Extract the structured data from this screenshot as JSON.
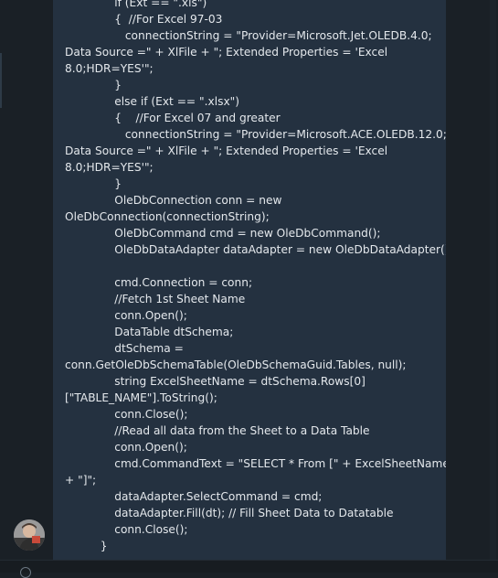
{
  "message": {
    "code_lines": [
      "              if (Ext == \".xls\")",
      "              {  //For Excel 97-03",
      "                 connectionString = \"Provider=Microsoft.Jet.OLEDB.4.0;",
      "Data Source =\" + XlFile + \"; Extended Properties = 'Excel",
      "8.0;HDR=YES'\";",
      "              }",
      "              else if (Ext == \".xlsx\")",
      "              {    //For Excel 07 and greater",
      "                 connectionString = \"Provider=Microsoft.ACE.OLEDB.12.0;",
      "Data Source =\" + XlFile + \"; Extended Properties = 'Excel",
      "8.0;HDR=YES'\";",
      "              }",
      "              OleDbConnection conn = new",
      "OleDbConnection(connectionString);",
      "              OleDbCommand cmd = new OleDbCommand();",
      "              OleDbDataAdapter dataAdapter = new OleDbDataAdapter();",
      "",
      "              cmd.Connection = conn;",
      "              //Fetch 1st Sheet Name",
      "              conn.Open();",
      "              DataTable dtSchema;",
      "              dtSchema =",
      "conn.GetOleDbSchemaTable(OleDbSchemaGuid.Tables, null);",
      "              string ExcelSheetName = dtSchema.Rows[0]",
      "[\"TABLE_NAME\"].ToString();",
      "              conn.Close();",
      "              //Read all data from the Sheet to a Data Table",
      "              conn.Open();",
      "              cmd.CommandText = \"SELECT * From [\" + ExcelSheetName",
      "+ \"]\";",
      "              dataAdapter.SelectCommand = cmd;",
      "              dataAdapter.Fill(dt); // Fill Sheet Data to Datatable",
      "              conn.Close();",
      "          }"
    ]
  },
  "avatar_icon": "user-avatar-icon",
  "colors": {
    "background": "#1a2026",
    "bubble": "#243140",
    "text": "#e4e8ec"
  }
}
